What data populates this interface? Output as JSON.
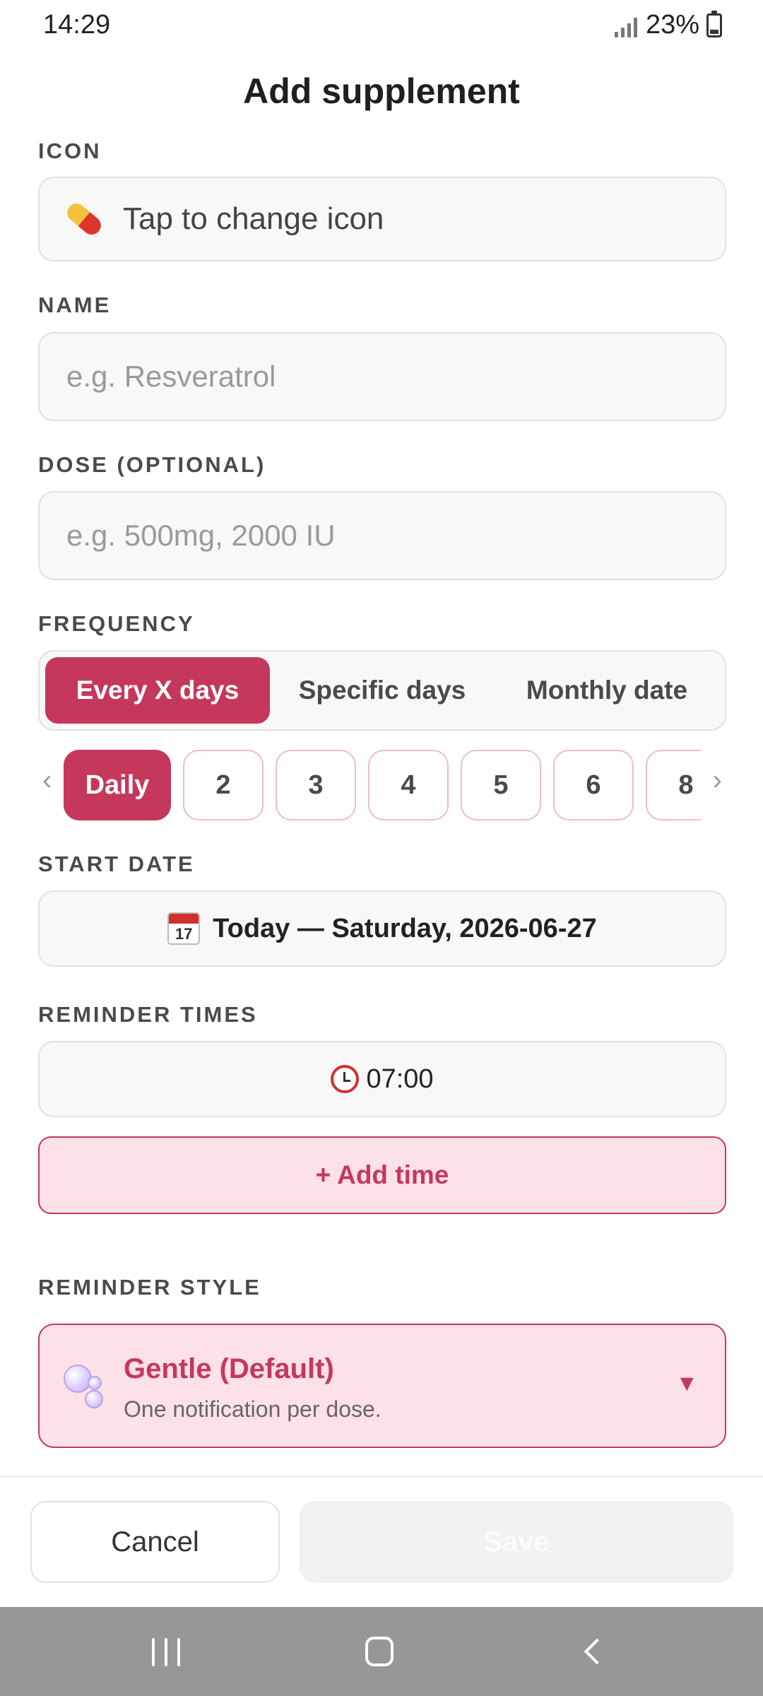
{
  "status_bar": {
    "time": "14:29",
    "battery": "23%"
  },
  "header": {
    "title": "Add supplement"
  },
  "icon_section": {
    "label": "ICON",
    "button_text": "Tap to change icon",
    "icon": "pill-icon"
  },
  "name_section": {
    "label": "NAME",
    "placeholder": "e.g. Resveratrol",
    "value": ""
  },
  "dose_section": {
    "label": "DOSE (OPTIONAL)",
    "placeholder": "e.g. 500mg, 2000 IU",
    "value": ""
  },
  "frequency": {
    "label": "FREQUENCY",
    "options": [
      "Every X days",
      "Specific days",
      "Monthly date"
    ],
    "selected": "Every X days",
    "intervals": [
      "Daily",
      "2",
      "3",
      "4",
      "5",
      "6",
      "8"
    ],
    "selected_interval": "Daily",
    "prev_glyph": "‹",
    "next_glyph": "›"
  },
  "start_date": {
    "label": "START DATE",
    "icon_day": "17",
    "value": "Today — Saturday, 2026-06-27"
  },
  "reminder_times": {
    "label": "REMINDER TIMES",
    "times": [
      "07:00"
    ],
    "add_label": "+ Add time"
  },
  "reminder_style": {
    "label": "REMINDER STYLE",
    "title": "Gentle (Default)",
    "description": "One notification per dose.",
    "caret": "▼",
    "icon": "bubbles-icon"
  },
  "footer": {
    "cancel_label": "Cancel",
    "save_label": "Save"
  },
  "colors": {
    "accent": "#c5385c",
    "accent_light": "#fde1e8",
    "field_bg": "#f8f8f8"
  }
}
